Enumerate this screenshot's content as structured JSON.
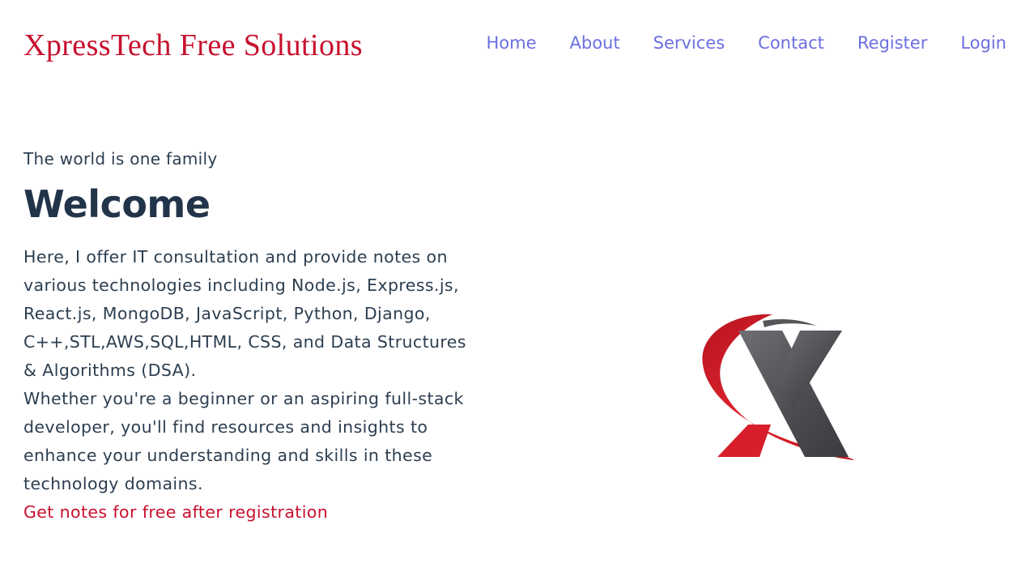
{
  "navbar": {
    "brand": "XpressTech Free Solutions",
    "links": [
      {
        "label": "Home"
      },
      {
        "label": "About"
      },
      {
        "label": "Services"
      },
      {
        "label": "Contact"
      },
      {
        "label": "Register"
      },
      {
        "label": "Login"
      }
    ]
  },
  "hero": {
    "tagline": "The world is one family",
    "heading": "Welcome",
    "paragraph_1": "Here, I offer IT consultation and provide notes on various technologies including Node.js, Express.js, React.js, MongoDB, JavaScript, Python, Django, C++,STL,AWS,SQL,HTML, CSS, and Data Structures & Algorithms (DSA).",
    "paragraph_2": "Whether you're a beginner or an aspiring full-stack developer, you'll find resources and insights to enhance your understanding and skills in these technology domains.",
    "cta": "Get notes for free after registration"
  },
  "logo": {
    "icon": "x-swoosh-logo",
    "colors": {
      "red": "#d81e2a",
      "gray": "#55565a"
    }
  },
  "colors": {
    "brand": "#c8102e",
    "nav_link": "#6b6fe0",
    "heading": "#22344a",
    "text": "#2c3e50"
  }
}
